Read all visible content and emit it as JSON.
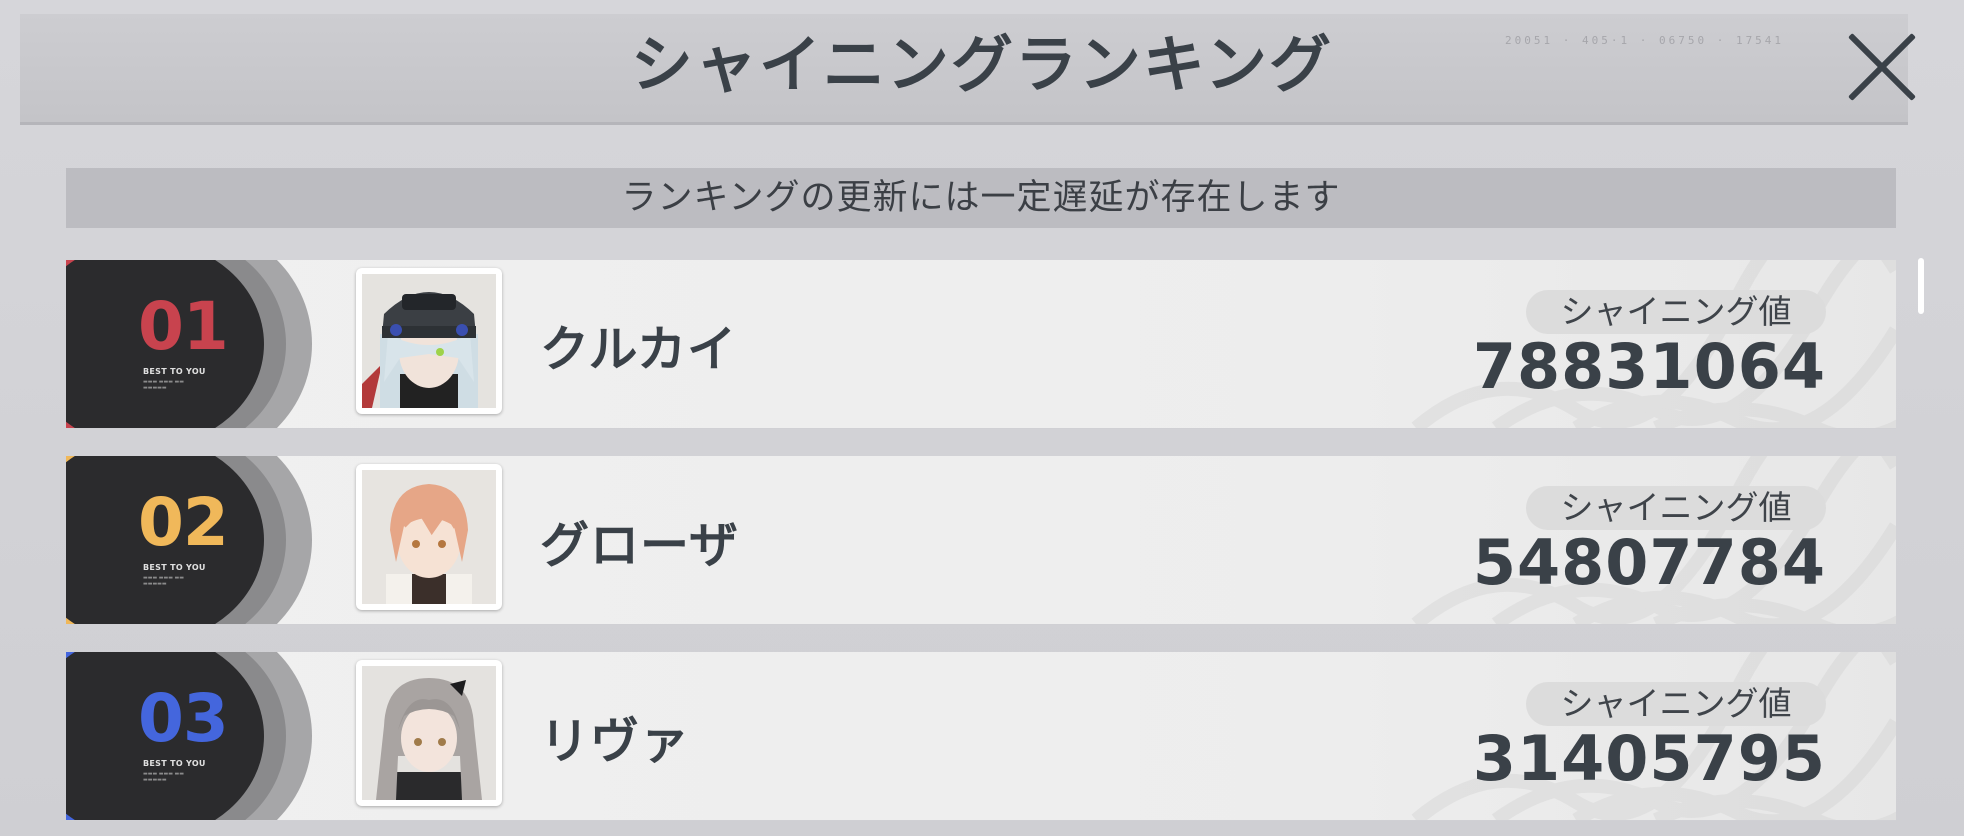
{
  "header": {
    "title": "シャイニングランキング",
    "deco": "20051 · 405·1 · 06750 · 17541"
  },
  "notice": "ランキングの更新には一定遅延が存在します",
  "rank_tagline": "BEST TO YOU",
  "rows": [
    {
      "rank": "01",
      "name": "クルカイ",
      "score_label": "シャイニング値",
      "score": "78831064",
      "accent": "#c8434e"
    },
    {
      "rank": "02",
      "name": "グローザ",
      "score_label": "シャイニング値",
      "score": "54807784",
      "accent": "#f0b85a"
    },
    {
      "rank": "03",
      "name": "リヴァ",
      "score_label": "シャイニング値",
      "score": "31405795",
      "accent": "#4466dd"
    }
  ],
  "icons": {
    "close": "close-x-icon"
  }
}
